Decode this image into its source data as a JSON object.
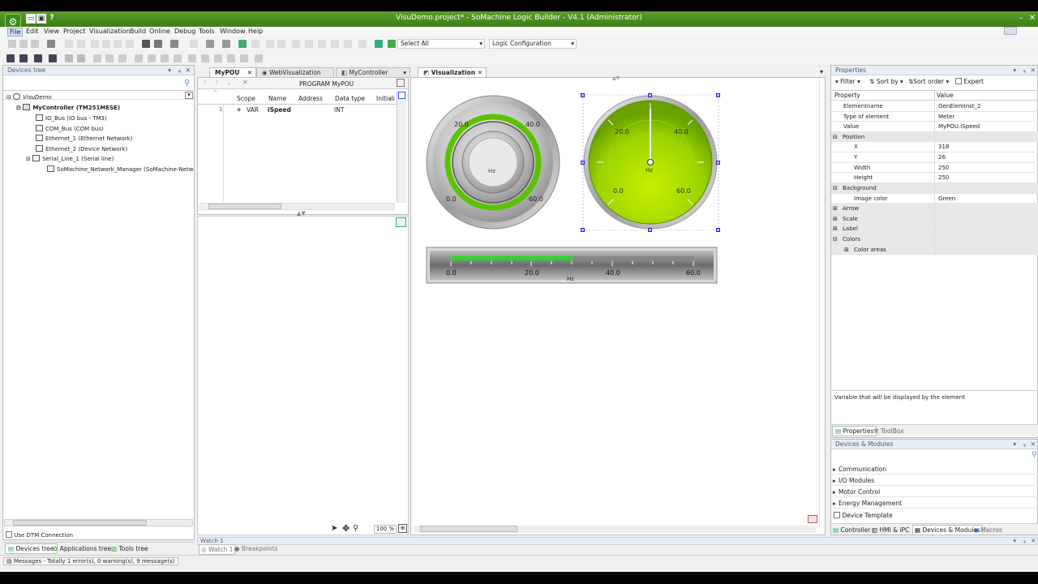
{
  "window": {
    "title": "VisuDemo.project* - SoMachine Logic Builder - V4.1 (Administrator)"
  },
  "quick_access": [
    "new-icon",
    "save-icon",
    "help-icon"
  ],
  "menu": [
    "File",
    "Edit",
    "View",
    "Project",
    "Visualization",
    "Build",
    "Online",
    "Debug",
    "Tools",
    "Window",
    "Help"
  ],
  "toolbar": {
    "select_all": "Select All",
    "config": "Logic Configuration"
  },
  "devices_tree": {
    "title": "Devices tree",
    "items": [
      {
        "label": "VisuDemo"
      },
      {
        "label": "MyController (TM251MESE)"
      },
      {
        "label": "IO_Bus (IO bus - TM3)"
      },
      {
        "label": "COM_Bus (COM bus)"
      },
      {
        "label": "Ethernet_1 (Ethernet Network)"
      },
      {
        "label": "Ethernet_2 (Device Network)"
      },
      {
        "label": "Serial_Line_1 (Serial line)"
      },
      {
        "label": "SoMachine_Network_Manager (SoMachine-Network"
      }
    ],
    "use_dtm": "Use DTM Connection",
    "tabs": [
      "Devices tree",
      "Applications tree",
      "Tools tree"
    ]
  },
  "editor_tabs": [
    "MyPOU",
    "WebVisualization",
    "MyController",
    "Visualization"
  ],
  "pou": {
    "program": "PROGRAM MyPOU",
    "columns": [
      "Scope",
      "Name",
      "Address",
      "Data type",
      "Initiali"
    ],
    "rows": [
      {
        "num": "1",
        "scope": "VAR",
        "name": "iSpeed",
        "address": "",
        "type": "INT"
      }
    ]
  },
  "visualization": {
    "meter1": {
      "ticks": [
        "20.0",
        "40.0",
        "0.0",
        "60.0"
      ],
      "unit": "Hz"
    },
    "meter2": {
      "ticks": [
        "20.0",
        "40.0",
        "0.0",
        "60.0"
      ],
      "unit": "Hz"
    },
    "bar": {
      "ticks": [
        "0.0",
        "20.0",
        "40.0",
        "60.0"
      ],
      "unit": "Hz",
      "fill_fraction": 0.5
    },
    "zoom": "100 %"
  },
  "properties": {
    "title": "Properties",
    "toolbar": {
      "filter": "Filter",
      "sort_by": "Sort by",
      "sort_order": "Sort order",
      "expert": "Expert"
    },
    "col_property": "Property",
    "col_value": "Value",
    "rows": [
      {
        "name": "Elementname",
        "value": "GenElemInst_2",
        "indent": 1,
        "group": false
      },
      {
        "name": "Type of element",
        "value": "Meter",
        "indent": 1,
        "group": false
      },
      {
        "name": "Value",
        "value": "MyPOU.iSpeed",
        "indent": 1,
        "group": false
      },
      {
        "name": "Position",
        "value": "",
        "indent": 0,
        "group": true,
        "sign": "⊟"
      },
      {
        "name": "X",
        "value": "318",
        "indent": 2,
        "group": false
      },
      {
        "name": "Y",
        "value": "26",
        "indent": 2,
        "group": false
      },
      {
        "name": "Width",
        "value": "250",
        "indent": 2,
        "group": false
      },
      {
        "name": "Height",
        "value": "250",
        "indent": 2,
        "group": false
      },
      {
        "name": "Background",
        "value": "",
        "indent": 0,
        "group": true,
        "sign": "⊟"
      },
      {
        "name": "Image color",
        "value": "Green",
        "indent": 2,
        "group": false
      },
      {
        "name": "Arrow",
        "value": "",
        "indent": 0,
        "group": true,
        "sign": "⊞"
      },
      {
        "name": "Scale",
        "value": "",
        "indent": 0,
        "group": true,
        "sign": "⊞"
      },
      {
        "name": "Label",
        "value": "",
        "indent": 0,
        "group": true,
        "sign": "⊞"
      },
      {
        "name": "Colors",
        "value": "",
        "indent": 0,
        "group": true,
        "sign": "⊟"
      },
      {
        "name": "Color areas",
        "value": "",
        "indent": 2,
        "group": true,
        "sign": "⊞"
      }
    ],
    "description": "Variable that will be displayed by the element",
    "tabs": [
      "Properties",
      "ToolBox"
    ]
  },
  "devices_modules": {
    "title": "Devices & Modules",
    "items": [
      "Communication",
      "I/O Modules",
      "Motor Control",
      "Energy Management"
    ],
    "device_template": "Device Template",
    "tabs": [
      "Controller",
      "HMI & iPC",
      "Devices & Modules",
      "Macros"
    ]
  },
  "watch": {
    "title": "Watch 1",
    "tabs": [
      "Watch 1",
      "Breakpoints"
    ]
  },
  "messages": "Messages - Totally 1 error(s), 0 warning(s), 9 message(s)",
  "colors": {
    "title_green": "#4a8e22",
    "gauge_green": "#8fd400",
    "bar_green": "#22dd22"
  }
}
